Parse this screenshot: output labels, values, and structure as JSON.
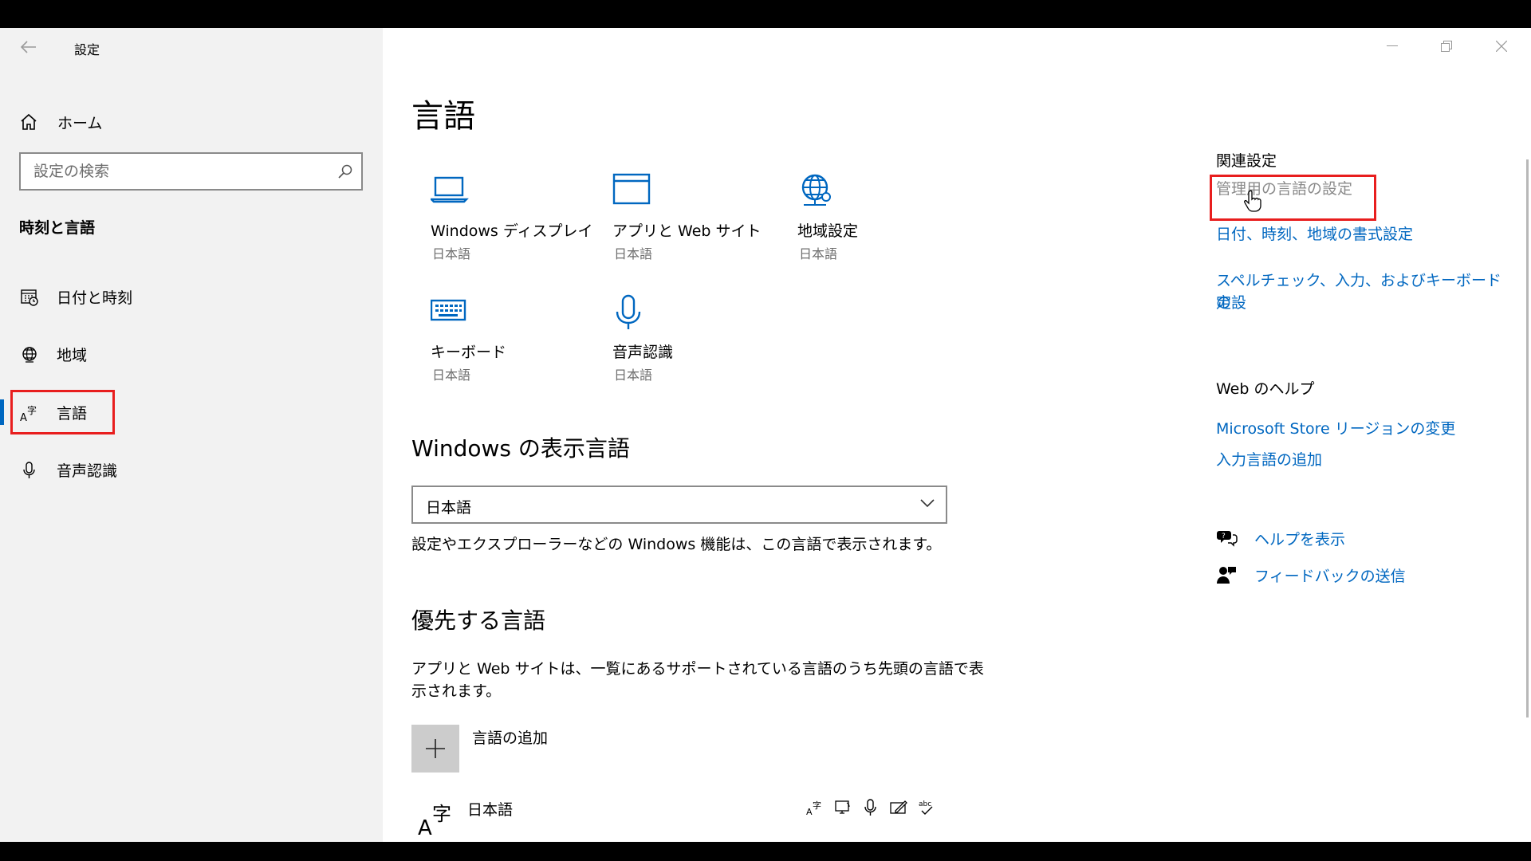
{
  "window": {
    "title": "設定",
    "controls": {
      "minimize": "minimize",
      "maximize": "restore",
      "close": "close"
    }
  },
  "sidebar": {
    "home_label": "ホーム",
    "search_placeholder": "設定の検索",
    "section_title": "時刻と言語",
    "items": [
      {
        "label": "日付と時刻",
        "icon": "calendar-clock-icon"
      },
      {
        "label": "地域",
        "icon": "globe-icon"
      },
      {
        "label": "言語",
        "icon": "language-icon",
        "active": true
      },
      {
        "label": "音声認識",
        "icon": "microphone-icon"
      }
    ]
  },
  "main": {
    "title": "言語",
    "tiles": [
      {
        "label": "Windows ディスプレイ",
        "sub": "日本語",
        "icon": "laptop-icon"
      },
      {
        "label": "アプリと Web サイト",
        "sub": "日本語",
        "icon": "window-icon"
      },
      {
        "label": "地域設定",
        "sub": "日本語",
        "icon": "globe-settings-icon"
      },
      {
        "label": "キーボード",
        "sub": "日本語",
        "icon": "keyboard-icon"
      },
      {
        "label": "音声認識",
        "sub": "日本語",
        "icon": "microphone-icon"
      }
    ],
    "display_language": {
      "heading": "Windows の表示言語",
      "selected": "日本語",
      "description": "設定やエクスプローラーなどの Windows 機能は、この言語で表示されます。"
    },
    "preferred_languages": {
      "heading": "優先する言語",
      "description_line1": "アプリと Web サイトは、一覧にあるサポートされている言語のうち先頭の言語で表",
      "description_line2": "示されます。",
      "add_label": "言語の追加",
      "languages": [
        {
          "label": "日本語",
          "features": [
            "display-language-icon",
            "text-to-speech-icon",
            "speech-recognition-icon",
            "handwriting-icon",
            "spellcheck-icon"
          ]
        }
      ]
    }
  },
  "related": {
    "heading": "関連設定",
    "links": [
      {
        "label": "管理用の言語の設定",
        "state": "hover"
      },
      {
        "label": "日付、時刻、地域の書式設定"
      },
      {
        "label_line1": "スペルチェック、入力、およびキーボードの設",
        "label_line2": "定"
      }
    ]
  },
  "web_help": {
    "heading": "Web のヘルプ",
    "links": [
      {
        "label": "Microsoft Store リージョンの変更"
      },
      {
        "label": "入力言語の追加"
      }
    ]
  },
  "support": {
    "help_label": "ヘルプを表示",
    "feedback_label": "フィードバックの送信"
  },
  "colors": {
    "accent": "#0067c0",
    "highlight_box": "#e81e1e",
    "sidebar_bg": "#f2f2f2"
  }
}
